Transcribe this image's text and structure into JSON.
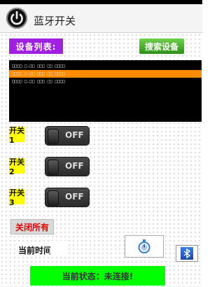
{
  "app": {
    "title": "蓝牙开关"
  },
  "toolbar": {
    "device_list_label": "设备列表:",
    "search_label": "搜索设备"
  },
  "devices": [
    {
      "name": "□□□□ □.□□ □□□ □□ □□□□"
    },
    {
      "name": "□□□□ □.□□ □□□ □□ □□□□",
      "selected": true
    },
    {
      "name": "□□□□ □.□□ □□□ □□ □□□□"
    }
  ],
  "switches": [
    {
      "label": "开关1",
      "state": "OFF"
    },
    {
      "label": "开关2",
      "state": "OFF"
    },
    {
      "label": "开关3",
      "state": "OFF"
    }
  ],
  "close_all_label": "关闭所有",
  "current_time_label": "当前时间",
  "status_text": "当前状态：未连接!",
  "icons": {
    "power": "power-icon",
    "stopwatch": "stopwatch-icon",
    "bluetooth": "bluetooth-icon"
  },
  "colors": {
    "accent_purple": "#a020e0",
    "search_green": "#3aa82a",
    "selected_row": "#ff8c00",
    "switch_label_bg": "#ffff00",
    "status_bg": "#00ff00",
    "close_text": "#e00000"
  }
}
